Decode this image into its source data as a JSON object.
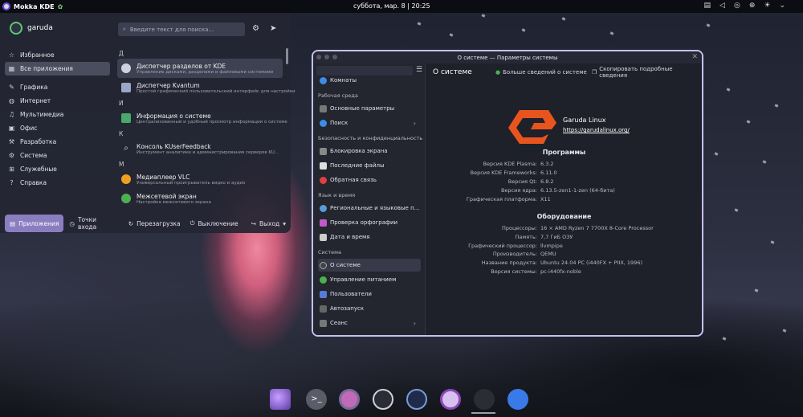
{
  "topbar": {
    "app_title": "Mokka KDE",
    "clock": "суббота, мар. 8 | 20:25"
  },
  "launcher": {
    "user": "garuda",
    "search_placeholder": "Введите текст для поиска...",
    "categories": [
      {
        "label": "Избранное",
        "icon": "star-icon"
      },
      {
        "label": "Все приложения",
        "icon": "grid-icon"
      },
      {
        "label": "Графика",
        "icon": "graphics-icon"
      },
      {
        "label": "Интернет",
        "icon": "globe-icon"
      },
      {
        "label": "Мультимедиа",
        "icon": "multimedia-icon"
      },
      {
        "label": "Офис",
        "icon": "office-icon"
      },
      {
        "label": "Разработка",
        "icon": "development-icon"
      },
      {
        "label": "Система",
        "icon": "system-icon"
      },
      {
        "label": "Служебные",
        "icon": "utilities-icon"
      },
      {
        "label": "Справка",
        "icon": "help-icon"
      }
    ],
    "app_groups": [
      {
        "letter": "Д",
        "apps": [
          {
            "name": "Диспетчер разделов от KDE",
            "desc": "Управление дисками, разделами и файловыми системами",
            "color": "#cfd2dc"
          },
          {
            "name": "Диспетчер Kvantum",
            "desc": "Простой графический пользовательский интерфейс для настройки",
            "color": "#9aa6c8"
          }
        ]
      },
      {
        "letter": "И",
        "apps": [
          {
            "name": "Информация о системе",
            "desc": "Централизованный и удобный просмотр информации о системе",
            "color": "#4aa86a"
          }
        ]
      },
      {
        "letter": "К",
        "apps": [
          {
            "name": "Консоль KUserFeedback",
            "desc": "Инструмент аналитики и администрирования серверов KU...",
            "color": "#cfd2dc"
          }
        ]
      },
      {
        "letter": "М",
        "apps": [
          {
            "name": "Медиаплеер VLC",
            "desc": "Универсальный проигрыватель видео и аудио",
            "color": "#f0a020"
          },
          {
            "name": "Межсетевой экран",
            "desc": "Настройка межсетевого экрана",
            "color": "#4caf50"
          }
        ]
      }
    ],
    "footer": {
      "apps_tab": "Приложения",
      "places_tab": "Точки входа",
      "reboot": "Перезагрузка",
      "shutdown": "Выключение",
      "logout": "Выход"
    }
  },
  "window": {
    "title": "О системе — Параметры системы",
    "sidebar": {
      "top_item": "Комнаты",
      "sections": [
        {
          "title": "Рабочая среда",
          "items": [
            "Основные параметры",
            "Поиск"
          ]
        },
        {
          "title": "Безопасность и конфиденциальность",
          "items": [
            "Блокировка экрана",
            "Последние файлы",
            "Обратная связь"
          ]
        },
        {
          "title": "Язык и время",
          "items": [
            "Региональные и языковые п...",
            "Проверка орфографии",
            "Дата и время"
          ]
        },
        {
          "title": "Система",
          "items": [
            "О системе",
            "Управление питанием",
            "Пользователи",
            "Автозапуск",
            "Сеанс"
          ]
        }
      ]
    },
    "main": {
      "page_title": "О системе",
      "more_info_button": "Больше сведений о системе",
      "copy_button": "Скопировать подробные сведения",
      "os_name": "Garuda Linux",
      "os_url": "https://garudalinux.org/",
      "software_title": "Программы",
      "software": [
        {
          "k": "Версия KDE Plasma:",
          "v": "6.3.2"
        },
        {
          "k": "Версия KDE Frameworks:",
          "v": "6.11.0"
        },
        {
          "k": "Версия Qt:",
          "v": "6.8.2"
        },
        {
          "k": "Версия ядра:",
          "v": "6.13.5-zen1-1-zen (64-бита)"
        },
        {
          "k": "Графическая платформа:",
          "v": "X11"
        }
      ],
      "hardware_title": "Оборудование",
      "hardware": [
        {
          "k": "Процессоры:",
          "v": "16 × AMD Ryzen 7 7700X 8-Core Processor"
        },
        {
          "k": "Память:",
          "v": "7,7 ГиБ ОЗУ"
        },
        {
          "k": "Графический процессор:",
          "v": "llvmpipe"
        },
        {
          "k": "Производитель:",
          "v": "QEMU"
        },
        {
          "k": "Название продукта:",
          "v": "Ubuntu 24.04 PC (i440FX + PIIX, 1996)"
        },
        {
          "k": "Версия системы:",
          "v": "pc-i440fx-noble"
        }
      ]
    }
  },
  "dock": [
    "garuda-icon",
    "terminal-icon",
    "settings-icon",
    "files-icon",
    "monitor-icon",
    "octopi-icon",
    "toggle-icon",
    "store-icon"
  ]
}
